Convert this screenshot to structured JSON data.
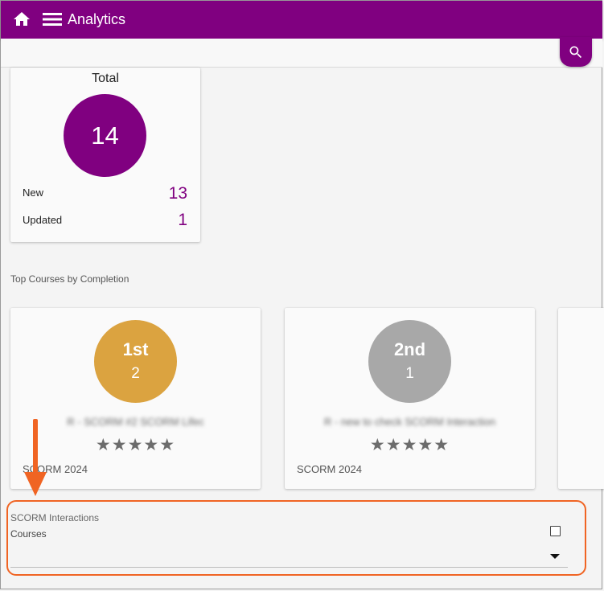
{
  "app": {
    "title": "Analytics"
  },
  "icons": {
    "home": "home-icon",
    "menu": "menu-icon",
    "search": "search-icon",
    "star": "star-icon",
    "arrow": "arrow-down-icon"
  },
  "colors": {
    "brand": "#800080",
    "first_place": "#dba340",
    "second_place": "#a8a8a8",
    "highlight": "#f06423"
  },
  "total": {
    "title": "Total",
    "count": "14",
    "new_label": "New",
    "new_value": "13",
    "updated_label": "Updated",
    "updated_value": "1"
  },
  "top_courses": {
    "label": "Top Courses by Completion",
    "cards": [
      {
        "place": "1st",
        "count": "2",
        "title": "R - SCORM #2 SCORM Lifec",
        "stars": "★★★★★",
        "rating": 5,
        "type": "SCORM 2024"
      },
      {
        "place": "2nd",
        "count": "1",
        "title": "R - new to check SCORM Interaction",
        "stars": "★★★★★",
        "rating": 5,
        "type": "SCORM 2024"
      }
    ]
  },
  "scorm_interactions": {
    "title": "SCORM Interactions",
    "courses_label": "Courses",
    "selected": ""
  }
}
